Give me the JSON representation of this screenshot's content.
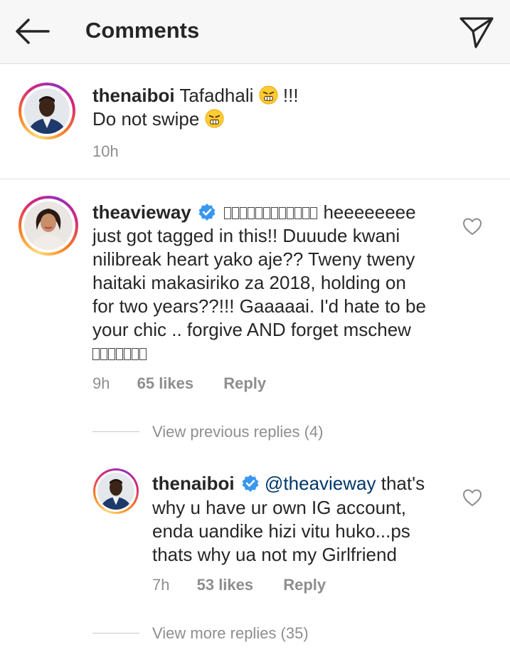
{
  "header": {
    "title": "Comments"
  },
  "caption": {
    "username": "thenaiboi",
    "line1_text": "Tafadhali",
    "line1_suffix": "!!!",
    "line2_text": "Do not swipe",
    "time": "10h"
  },
  "comment": {
    "username": "theavieway",
    "first_text": "heeeeeeee",
    "lines": [
      "just got tagged in this!! Duuude kwani",
      "nilibreak heart yako aje?? Tweny tweny",
      "haitaki makasiriko za 2018, holding on",
      "for two years??!!! Gaaaaai. I'd hate to be",
      "your chic .. forgive AND forget mschew"
    ],
    "time": "9h",
    "likes": "65 likes",
    "reply": "Reply",
    "view_previous": "View previous replies (4)"
  },
  "reply": {
    "username": "thenaiboi",
    "mention": "@theavieway",
    "first_text": "that's",
    "lines": [
      "why u have ur own IG account,",
      "enda uandike hizi vitu huko...ps",
      "thats why ua not my Girlfriend"
    ],
    "time": "7h",
    "likes": "53 likes",
    "reply": "Reply",
    "view_more": "View more replies (35)"
  },
  "colors": {
    "mention": "#00376b",
    "verified": "#3897f0",
    "meta": "#8e8e8e"
  },
  "icons": [
    "back-arrow-icon",
    "send-icon",
    "verified-badge-icon",
    "heart-icon",
    "angry-emoji-icon"
  ]
}
